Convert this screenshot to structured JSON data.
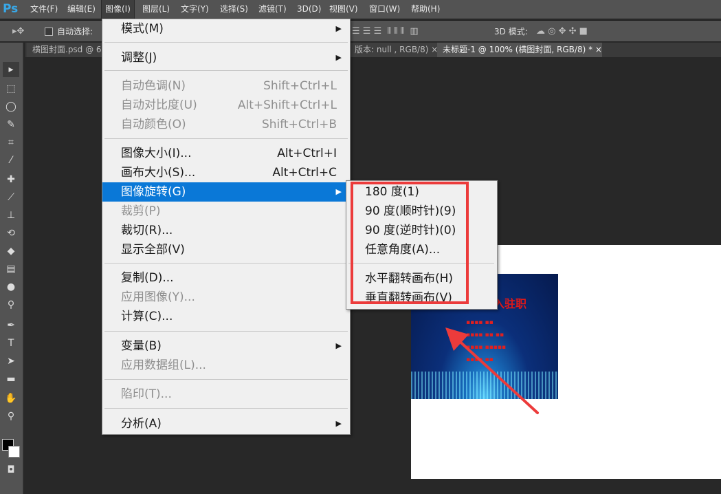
{
  "app": {
    "logo": "Ps"
  },
  "menubar": {
    "items": [
      "文件(F)",
      "编辑(E)",
      "图像(I)",
      "图层(L)",
      "文字(Y)",
      "选择(S)",
      "滤镜(T)",
      "3D(D)",
      "视图(V)",
      "窗口(W)",
      "帮助(H)"
    ],
    "active_index": 2
  },
  "options": {
    "auto_select": "自动选择:",
    "mode_3d": "3D 模式:"
  },
  "tabs": [
    {
      "label": "横图封面.psd @ 66"
    },
    {
      "label": "版本: null , RGB/8)",
      "close": "×"
    },
    {
      "label": "未标题-1 @ 100% (横图封面, RGB/8) *",
      "close": "×"
    }
  ],
  "image_menu": {
    "items": [
      {
        "label": "模式(M)",
        "shortcut": "",
        "submenu": true,
        "disabled": false
      },
      {
        "label": "调整(J)",
        "shortcut": "",
        "submenu": true,
        "disabled": false
      },
      {
        "label": "自动色调(N)",
        "shortcut": "Shift+Ctrl+L",
        "submenu": false,
        "disabled": true
      },
      {
        "label": "自动对比度(U)",
        "shortcut": "Alt+Shift+Ctrl+L",
        "submenu": false,
        "disabled": true
      },
      {
        "label": "自动颜色(O)",
        "shortcut": "Shift+Ctrl+B",
        "submenu": false,
        "disabled": true
      },
      {
        "label": "图像大小(I)...",
        "shortcut": "Alt+Ctrl+I",
        "submenu": false,
        "disabled": false
      },
      {
        "label": "画布大小(S)...",
        "shortcut": "Alt+Ctrl+C",
        "submenu": false,
        "disabled": false
      },
      {
        "label": "图像旋转(G)",
        "shortcut": "",
        "submenu": true,
        "disabled": false,
        "highlighted": true
      },
      {
        "label": "裁剪(P)",
        "shortcut": "",
        "submenu": false,
        "disabled": true
      },
      {
        "label": "裁切(R)...",
        "shortcut": "",
        "submenu": false,
        "disabled": false
      },
      {
        "label": "显示全部(V)",
        "shortcut": "",
        "submenu": false,
        "disabled": false
      },
      {
        "label": "复制(D)...",
        "shortcut": "",
        "submenu": false,
        "disabled": false
      },
      {
        "label": "应用图像(Y)...",
        "shortcut": "",
        "submenu": false,
        "disabled": true
      },
      {
        "label": "计算(C)...",
        "shortcut": "",
        "submenu": false,
        "disabled": false
      },
      {
        "label": "变量(B)",
        "shortcut": "",
        "submenu": true,
        "disabled": false
      },
      {
        "label": "应用数据组(L)...",
        "shortcut": "",
        "submenu": false,
        "disabled": true
      },
      {
        "label": "陷印(T)...",
        "shortcut": "",
        "submenu": false,
        "disabled": true
      },
      {
        "label": "分析(A)",
        "shortcut": "",
        "submenu": true,
        "disabled": false
      }
    ]
  },
  "rotate_submenu": {
    "items": [
      "180 度(1)",
      "90 度(顺时针)(9)",
      "90 度(逆时针)(0)",
      "任意角度(A)...",
      "水平翻转画布(H)",
      "垂直翻转画布(V)"
    ]
  },
  "colors": {
    "highlight": "#0a78d7",
    "annotation": "#ec3b3b"
  },
  "canvas_image": {
    "title_fragment": "入驻职"
  }
}
